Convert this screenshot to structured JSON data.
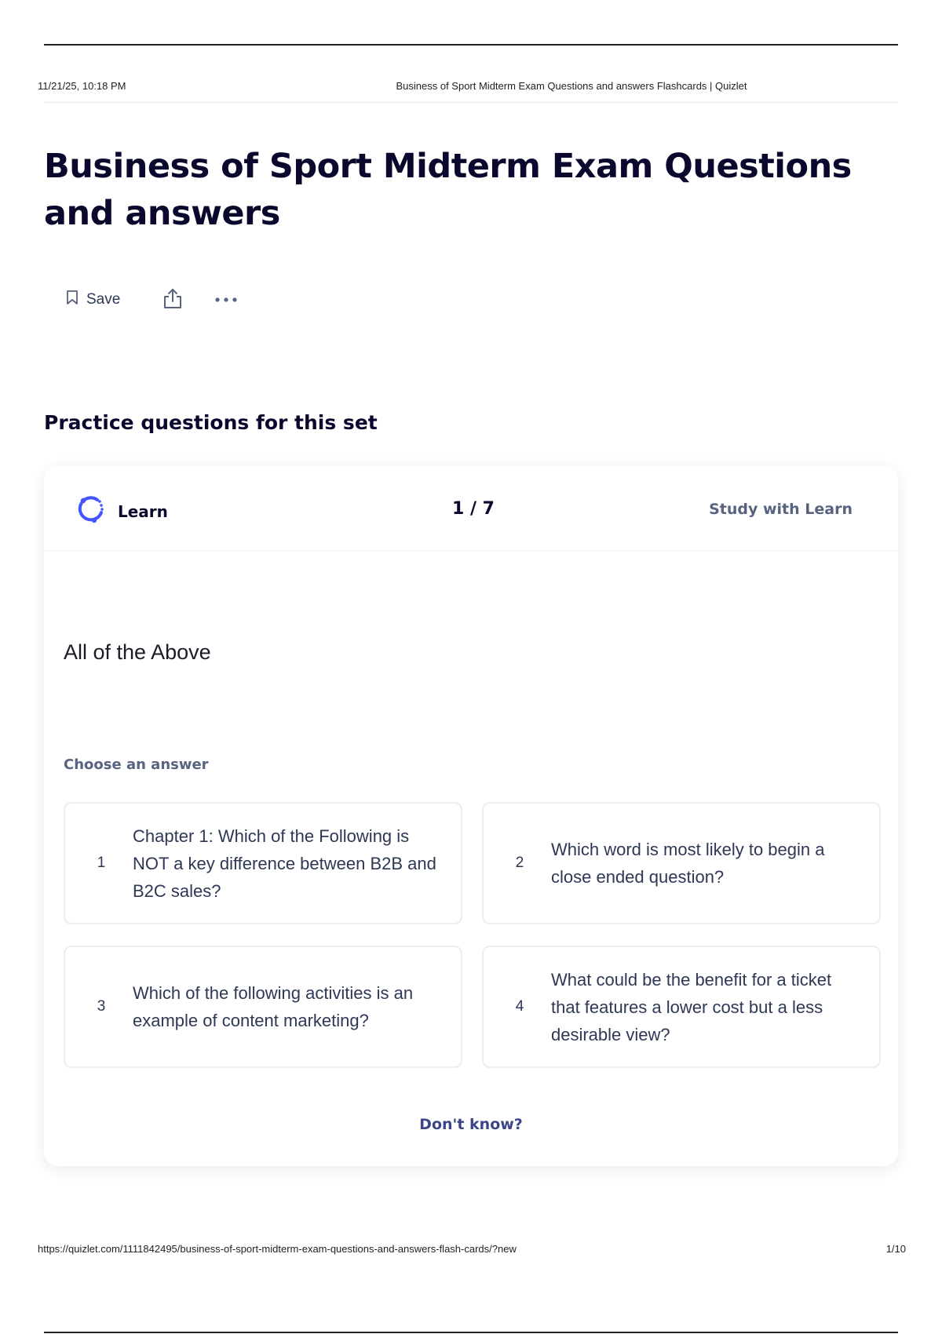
{
  "print_header": {
    "date": "11/21/25, 10:18 PM",
    "doc_title": "Business of Sport Midterm Exam Questions and answers Flashcards | Quizlet"
  },
  "set": {
    "title": "Business of Sport Midterm Exam Questions and answers"
  },
  "actions": {
    "save_label": "Save",
    "save_icon": "bookmark-icon",
    "share_icon": "share-icon",
    "more_icon": "more-horizontal-icon"
  },
  "practice": {
    "heading": "Practice questions for this set",
    "mode_label": "Learn",
    "mode_icon": "learn-icon",
    "counter": "1 / 7",
    "study_link": "Study with Learn",
    "prompt": "All of the Above",
    "choose_label": "Choose an answer",
    "options": [
      {
        "num": "1",
        "text": "Chapter 1: Which of the Following is NOT a key difference between B2B and B2C sales?"
      },
      {
        "num": "2",
        "text": "Which word is most likely to begin a close ended question?"
      },
      {
        "num": "3",
        "text": "Which of the following activities is an example of content marketing?"
      },
      {
        "num": "4",
        "text": "What could be the benefit for a ticket that features a lower cost but a less desirable view?"
      }
    ],
    "dont_know": "Don't know?"
  },
  "print_footer": {
    "url": "https://quizlet.com/1111842495/business-of-sport-midterm-exam-questions-and-answers-flash-cards/?new",
    "page": "1/10"
  },
  "colors": {
    "title": "#0a092d",
    "muted": "#586380",
    "accent": "#4255ff",
    "link": "#3a4687"
  }
}
